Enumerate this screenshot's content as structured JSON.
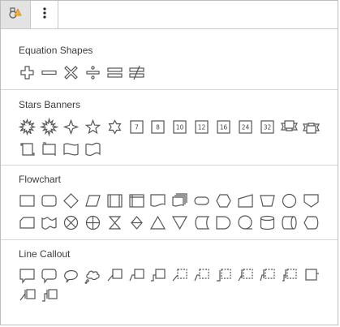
{
  "toolbar": {
    "tabs": [
      {
        "name": "shapes-tab",
        "icon": "shapes-icon",
        "active": true
      },
      {
        "name": "more-options-tab",
        "icon": "vertical-ellipsis-icon",
        "active": false
      }
    ]
  },
  "sections": [
    {
      "title": "Equation Shapes",
      "shapes": [
        "plus",
        "minus",
        "multiply",
        "divide",
        "equal",
        "not-equal"
      ]
    },
    {
      "title": "Stars Banners",
      "shapes": [
        "explosion-1",
        "explosion-2",
        "star-4-point",
        "star-5-point",
        "star-6-point",
        "star-7",
        "star-8",
        "star-10",
        "star-12",
        "star-16",
        "star-24",
        "star-32",
        "ribbon-down",
        "ribbon-up",
        "scroll-vertical",
        "scroll-horizontal",
        "wave",
        "double-wave"
      ],
      "labels": {
        "star-7": "7",
        "star-8": "8",
        "star-10": "10",
        "star-12": "12",
        "star-16": "16",
        "star-24": "24",
        "star-32": "32"
      }
    },
    {
      "title": "Flowchart",
      "shapes": [
        "process",
        "alternate-process",
        "decision",
        "data",
        "predefined-process",
        "internal-storage",
        "document",
        "multi-document",
        "terminator",
        "preparation",
        "manual-input",
        "manual-operation",
        "connector",
        "off-page-connector",
        "card",
        "punched-tape",
        "summing-junction",
        "or",
        "collate",
        "sort",
        "extract",
        "merge",
        "stored-data",
        "delay",
        "sequential-access-storage",
        "magnetic-disk",
        "direct-access-storage",
        "display"
      ]
    },
    {
      "title": "Line Callout",
      "shapes": [
        "rectangle-callout",
        "rounded-rectangle-callout",
        "oval-callout",
        "cloud-callout",
        "line-callout-1",
        "line-callout-2",
        "line-callout-3",
        "line-callout-1-no-border",
        "line-callout-2-no-border",
        "line-callout-3-no-border",
        "line-callout-1-accent",
        "line-callout-2-accent",
        "line-callout-3-accent",
        "line-callout-4",
        "line-callout-1-border-accent",
        "line-callout-2-border-accent"
      ]
    }
  ]
}
